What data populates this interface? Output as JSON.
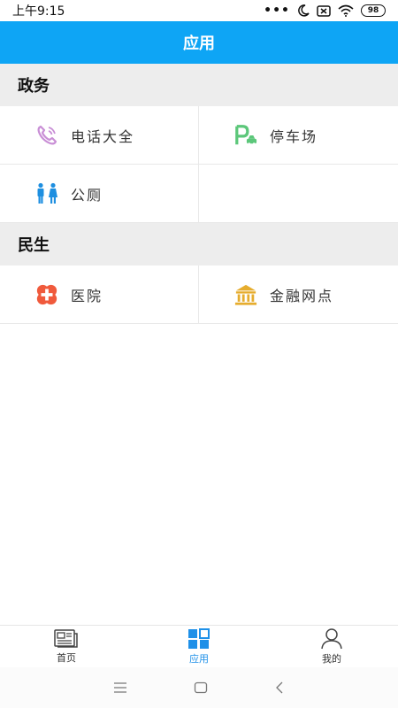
{
  "status_bar": {
    "time": "上午9:15",
    "battery": "98"
  },
  "header": {
    "title": "应用"
  },
  "sections": [
    {
      "title": "政务",
      "items": [
        {
          "label": "电话大全",
          "icon": "phone-icon"
        },
        {
          "label": "停车场",
          "icon": "parking-icon"
        },
        {
          "label": "公厕",
          "icon": "restroom-icon"
        }
      ]
    },
    {
      "title": "民生",
      "items": [
        {
          "label": "医院",
          "icon": "hospital-icon"
        },
        {
          "label": "金融网点",
          "icon": "bank-icon"
        }
      ]
    }
  ],
  "bottom_nav": [
    {
      "label": "首页",
      "icon": "news-icon"
    },
    {
      "label": "应用",
      "icon": "apps-grid-icon",
      "active": true
    },
    {
      "label": "我的",
      "icon": "person-icon"
    }
  ],
  "colors": {
    "header_bg": "#0ea5f5",
    "phone": "#c98fd6",
    "parking": "#5cc77a",
    "restroom": "#1e8fe0",
    "hospital": "#f05a3c",
    "bank": "#e6ad2e",
    "nav_active": "#1e90e8"
  }
}
